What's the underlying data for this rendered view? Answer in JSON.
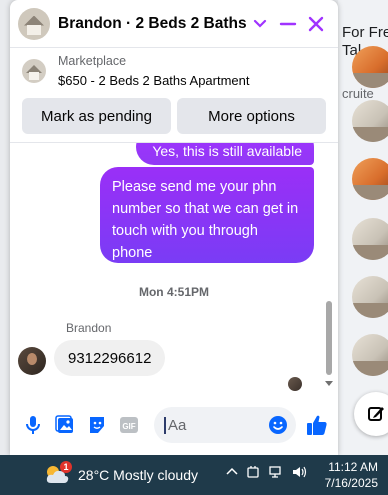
{
  "background": {
    "right_text_1": "For Fre",
    "right_text_2": "Tal",
    "right_text_3": "cruite"
  },
  "chat": {
    "title": "Brandon · 2 Beds 2 Baths ...",
    "listing": {
      "source": "Marketplace",
      "title": "$650 - 2 Beds 2 Baths Apartment"
    },
    "actions": {
      "mark_pending": "Mark as pending",
      "more_options": "More options"
    },
    "messages": {
      "outgoing_partial": "Yes, this is still available",
      "outgoing": "Please send me your phn number so that we can get in touch with you through phone",
      "timestamp": "Mon 4:51PM",
      "sender_name": "Brandon",
      "incoming": "9312296612"
    },
    "composer": {
      "placeholder": "Aa",
      "value": ""
    },
    "colors": {
      "accent": "#a033ff",
      "outgoing_bubble": "#8b3cf7",
      "composer_icons": "#0866ff"
    }
  },
  "taskbar": {
    "weather": "28°C  Mostly cloudy",
    "weather_badge": "1",
    "time": "11:12 AM",
    "date": "7/16/2025"
  }
}
